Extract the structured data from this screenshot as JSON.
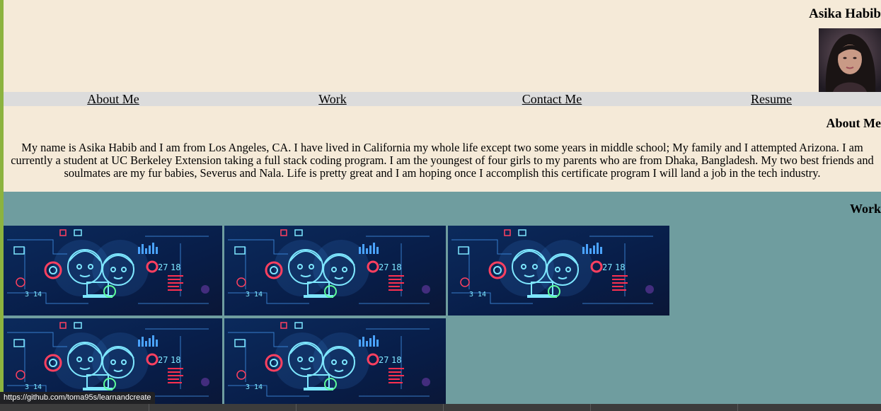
{
  "header": {
    "name": "Asika Habib",
    "avatar_alt": "profile-photo"
  },
  "nav": {
    "items": [
      {
        "label": "About Me"
      },
      {
        "label": "Work"
      },
      {
        "label": "Contact Me"
      },
      {
        "label": "Resume"
      }
    ]
  },
  "about": {
    "heading": "About Me",
    "body": "My name is Asika Habib and I am from Los Angeles, CA. I have lived in California my whole life except two some years in middle school; My family and I attempted Arizona. I am currently a student at UC Berkeley Extension taking a full stack coding program. I am the youngest of four girls to my parents who are from Dhaka, Bangladesh. My two best friends and soulmates are my fur babies, Severus and Nala. Life is pretty great and I am hoping once I accomplish this certificate program I will land a job in the tech industry."
  },
  "work": {
    "heading": "Work",
    "tiles": [
      {
        "image": "coding-illustration"
      },
      {
        "image": "coding-illustration"
      },
      {
        "image": "coding-illustration"
      },
      {
        "image": "coding-illustration"
      },
      {
        "image": "coding-illustration"
      }
    ]
  },
  "status_bar": {
    "url": "https://github.com/toma95s/learnandcreate"
  },
  "colors": {
    "page_bg": "#f5ead8",
    "nav_bg": "#dcdcdc",
    "work_bg": "#6f9d9f",
    "accent": "#8cb33f"
  }
}
